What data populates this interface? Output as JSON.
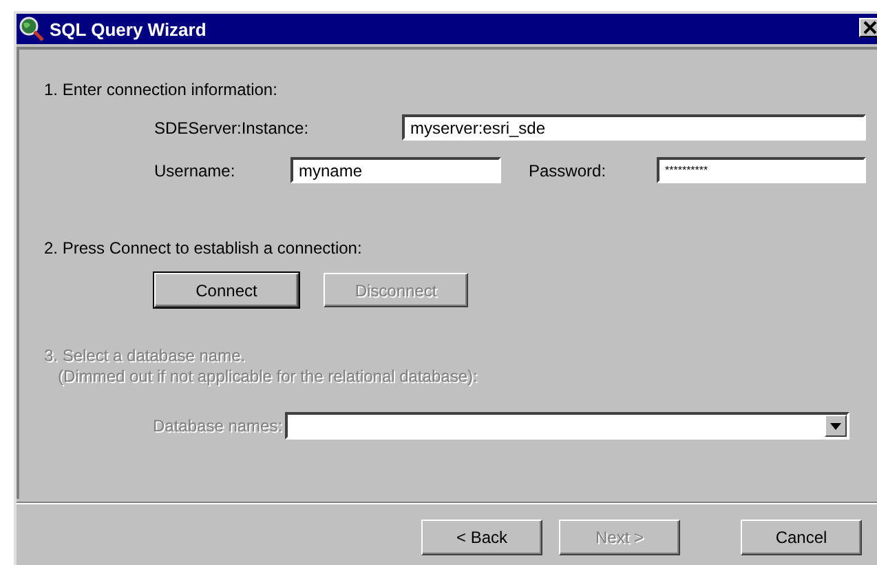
{
  "window": {
    "title": "SQL Query Wizard"
  },
  "step1": {
    "heading": "1. Enter connection information:",
    "server": {
      "label": "SDEServer:Instance:",
      "value": "myserver:esri_sde"
    },
    "username": {
      "label": "Username:",
      "value": "myname"
    },
    "password": {
      "label": "Password:",
      "value": "**********"
    }
  },
  "step2": {
    "heading": "2. Press Connect to establish a connection:",
    "buttons": [
      {
        "label": "Connect",
        "disabled": false,
        "default": true
      },
      {
        "label": "Disconnect",
        "disabled": true,
        "default": false
      }
    ]
  },
  "step3": {
    "disabled": true,
    "heading": "3. Select a database name.",
    "note": "(Dimmed out if not applicable for the relational database):",
    "database": {
      "label": "Database names:"
    }
  },
  "footer_buttons": [
    {
      "label": "< Back",
      "disabled": false
    },
    {
      "label": "Next >",
      "disabled": true
    },
    {
      "label": "Cancel",
      "disabled": false
    }
  ]
}
